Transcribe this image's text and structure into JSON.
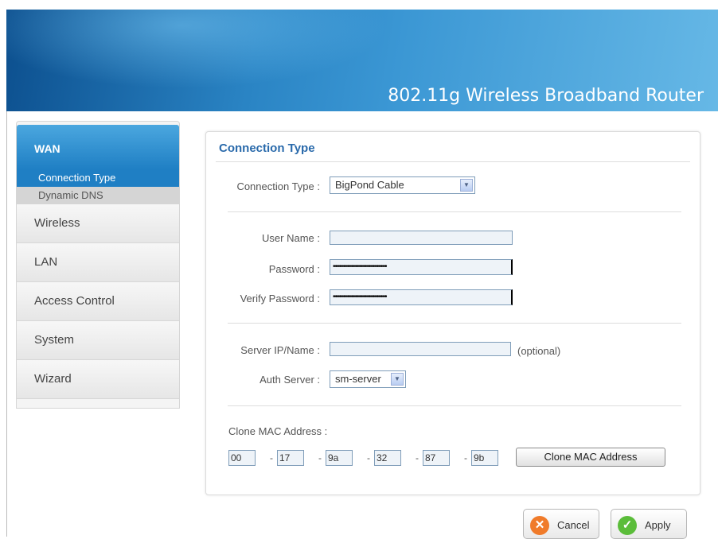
{
  "header": {
    "title": "802.11g Wireless Broadband Router"
  },
  "sidebar": {
    "wan_label": "WAN",
    "sub_items": [
      "Connection Type",
      "Dynamic DNS"
    ],
    "items": [
      "Wireless",
      "LAN",
      "Access Control",
      "System",
      "Wizard"
    ]
  },
  "panel": {
    "title": "Connection Type",
    "connection_type": {
      "label": "Connection Type :",
      "value": "BigPond Cable"
    },
    "user_name": {
      "label": "User Name :",
      "value": ""
    },
    "password": {
      "label": "Password :",
      "value": "•••••••••••••••••••••••••••"
    },
    "verify_password": {
      "label": "Verify Password :",
      "value": "•••••••••••••••••••••••••••"
    },
    "server": {
      "label": "Server IP/Name :",
      "value": "",
      "note": "(optional)"
    },
    "auth_server": {
      "label": "Auth Server :",
      "value": "sm-server"
    },
    "clone_mac": {
      "label": "Clone MAC Address :",
      "octets": [
        "00",
        "17",
        "9a",
        "32",
        "87",
        "9b"
      ],
      "separator": "-",
      "button": "Clone MAC Address"
    }
  },
  "actions": {
    "cancel": "Cancel",
    "apply": "Apply"
  },
  "colors": {
    "accent": "#1f7fc4",
    "title": "#2a6aab",
    "cancel": "#f07b2a",
    "apply": "#5bbd3a"
  },
  "icons": {
    "cancel": "x-circle-icon",
    "apply": "check-circle-icon",
    "dropdown": "chevron-down-icon"
  }
}
